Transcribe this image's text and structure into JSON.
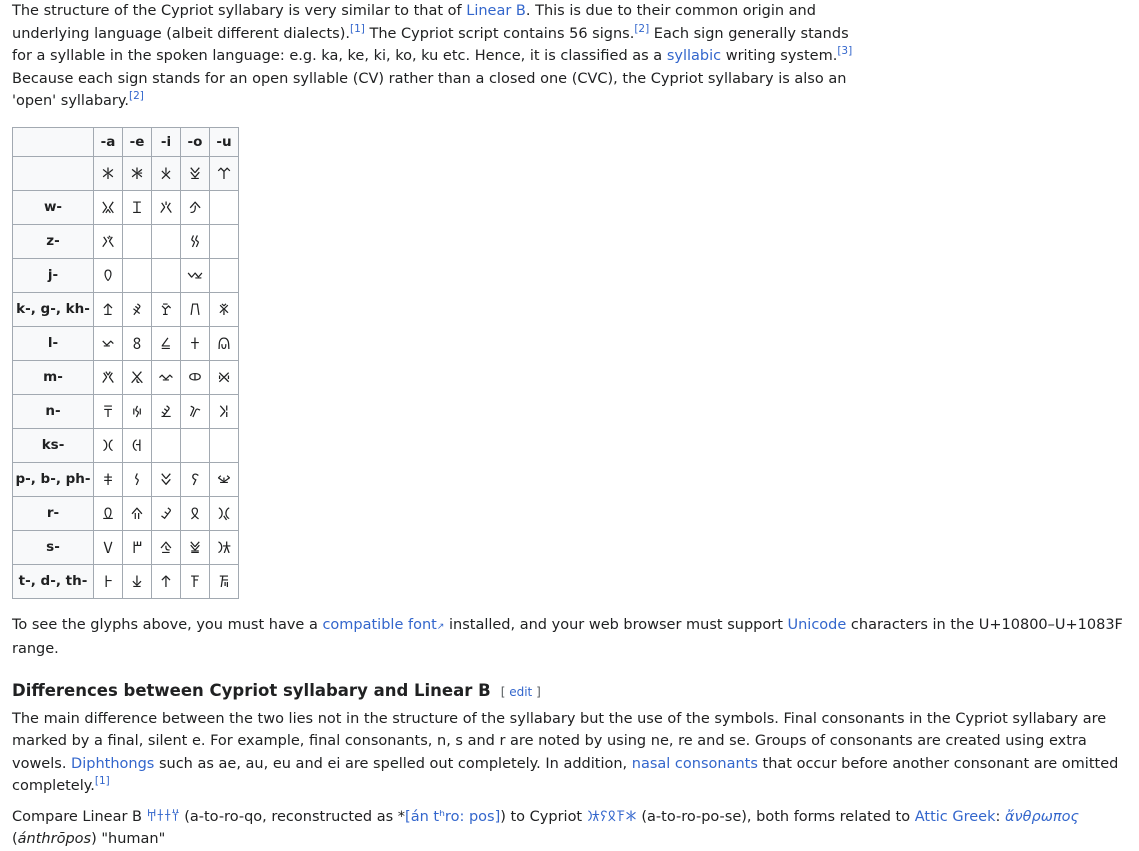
{
  "intro": {
    "t1": "The structure of the Cypriot syllabary is very similar to that of ",
    "link_linear_b": "Linear B",
    "t2": ". This is due to their common origin and underlying language (albeit different dialects).",
    "ref1": "[1]",
    "t3": " The Cypriot script contains 56 signs.",
    "ref2": "[2]",
    "t4": " Each sign generally stands for a syllable in the spoken language: e.g. ka, ke, ki, ko, ku etc. Hence, it is classified as a ",
    "link_syllabic": "syllabic",
    "t5": " writing system.",
    "ref3": "[3]",
    "t6": " Because each sign stands for an open syllable (CV) rather than a closed one (CVC), the Cypriot syllabary is also an 'open' syllabary.",
    "ref4": "[2]"
  },
  "table": {
    "columns": [
      "",
      "-a",
      "-e",
      "-i",
      "-o",
      "-u"
    ],
    "vowel_row": [
      "𐠀",
      "𐠁",
      "𐠂",
      "𐠃",
      "𐠄"
    ],
    "rows": [
      {
        "label": "w-",
        "cells": [
          "𐠲",
          "𐠳",
          "𐠴",
          "𐠵",
          ""
        ]
      },
      {
        "label": "z-",
        "cells": [
          "𐠼",
          "",
          "",
          "𐠿",
          ""
        ]
      },
      {
        "label": "j-",
        "cells": [
          "𐠅",
          "",
          "",
          "𐠈",
          ""
        ]
      },
      {
        "label": "k-, g-, kh-",
        "cells": [
          "𐠊",
          "𐠋",
          "𐠌",
          "𐠍",
          "𐠎"
        ]
      },
      {
        "label": "l-",
        "cells": [
          "𐠏",
          "𐠐",
          "𐠑",
          "𐠒",
          "𐠓"
        ]
      },
      {
        "label": "m-",
        "cells": [
          "𐠔",
          "𐠕",
          "𐠖",
          "𐠗",
          "𐠘"
        ]
      },
      {
        "label": "n-",
        "cells": [
          "𐠙",
          "𐠚",
          "𐠛",
          "𐠜",
          "𐠝"
        ]
      },
      {
        "label": "ks-",
        "cells": [
          "𐠷",
          "𐠸",
          "",
          "",
          ""
        ]
      },
      {
        "label": "p-, b-, ph-",
        "cells": [
          "𐠞",
          "𐠟",
          "𐠠",
          "𐠡",
          "𐠢"
        ]
      },
      {
        "label": "r-",
        "cells": [
          "𐠣",
          "𐠤",
          "𐠥",
          "𐠦",
          "𐠧"
        ]
      },
      {
        "label": "s-",
        "cells": [
          "𐠨",
          "𐠩",
          "𐠪",
          "𐠫",
          "𐠬"
        ]
      },
      {
        "label": "t-, d-, th-",
        "cells": [
          "𐠭",
          "𐠮",
          "𐠯",
          "𐠰",
          "𐠱"
        ]
      }
    ]
  },
  "note": {
    "t1": "To see the glyphs above, you must have a ",
    "link_font": "compatible font",
    "t2": " installed, and your web browser must support ",
    "link_unicode": "Unicode",
    "t3": " characters in the U+10800–U+1083F range."
  },
  "section": {
    "heading": "Differences between Cypriot syllabary and Linear B",
    "edit_open": "[ ",
    "edit_link": "edit",
    "edit_close": " ]"
  },
  "para3": {
    "t1": "The main difference between the two lies not in the structure of the syllabary but the use of the symbols. Final consonants in the Cypriot syllabary are marked by a final, silent e. For example, final consonants, n, s and r are noted by using ne, re and se. Groups of consonants are created using extra vowels. ",
    "link_diph": "Diphthongs",
    "t2": " such as ae, au, eu and ei are spelled out completely. In addition, ",
    "link_nasal": "nasal consonants",
    "t3": " that occur before another consonant are omitted completely.",
    "ref": "[1]"
  },
  "para4": {
    "t1": "Compare Linear B ",
    "lb_glyphs": "𐀀𐀫𐀫𐀦",
    "t2": " (a-to-ro-qo, reconstructed as *",
    "ipa": "[án tʰro: pos]",
    "t3": ") to Cypriot ",
    "cy_glyphs": "𐠀𐠰𐠦𐠡𐠬",
    "t4": " (a-to-ro-po-se), both forms related to ",
    "link_attic": "Attic Greek",
    "t5": ": ",
    "greek": "ἄνθρωπος",
    "t6": " (",
    "translit": "ánthrōpos",
    "t7": ") \"human\""
  }
}
